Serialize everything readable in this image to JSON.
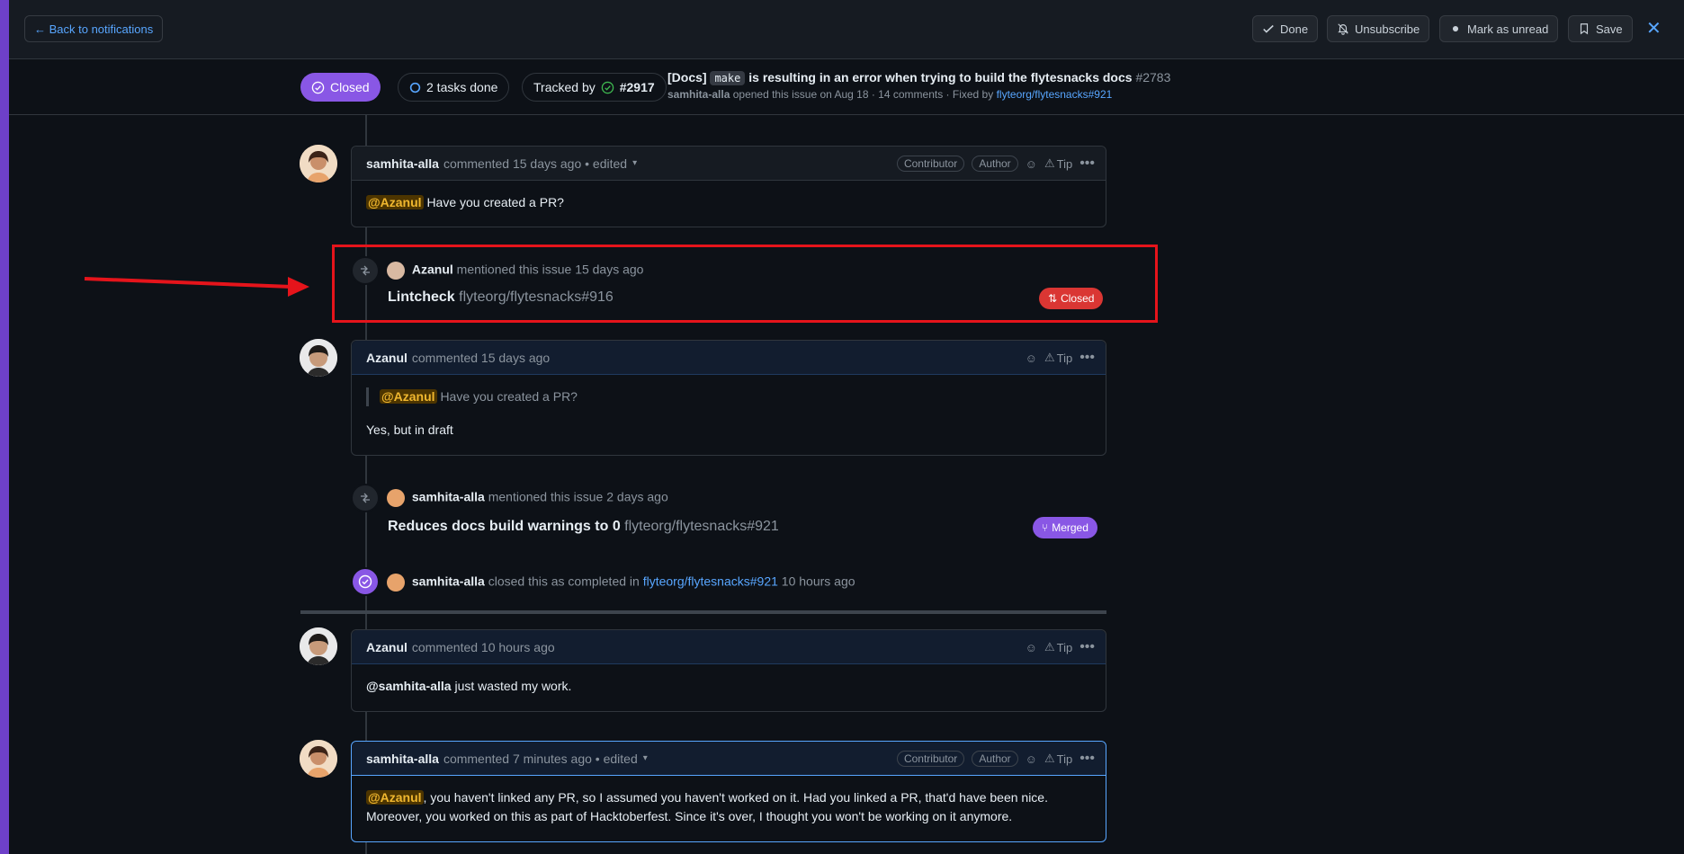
{
  "topbar": {
    "back_label": "← Back to notifications",
    "done_label": "Done",
    "unsubscribe_label": "Unsubscribe",
    "mark_unread_label": "Mark as unread",
    "save_label": "Save",
    "close_label": "✕"
  },
  "issue": {
    "state": "Closed",
    "tasks": "2 tasks done",
    "tracked_by_prefix": "Tracked by",
    "tracked_by_num": "#2917",
    "title_prefix": "[Docs]",
    "title_code": "make",
    "title_rest": "is resulting in an error when trying to build the flytesnacks docs",
    "number": "#2783",
    "sub_author": "samhita-alla",
    "sub_text": "opened this issue on Aug 18 · 14 comments · Fixed by",
    "sub_link": "flyteorg/flytesnacks#921"
  },
  "timeline": {
    "c1": {
      "author": "samhita-alla",
      "meta": "commented 15 days ago • edited",
      "labels": [
        "Contributor",
        "Author"
      ],
      "tip": "Tip",
      "mention": "@Azanul",
      "body": "Have you created a PR?"
    },
    "e1": {
      "actor": "Azanul",
      "text": "mentioned this issue 15 days ago",
      "ref_title": "Lintcheck",
      "ref_repo": "flyteorg/flytesnacks#916",
      "state": "Closed"
    },
    "c2": {
      "author": "Azanul",
      "meta": "commented 15 days ago",
      "tip": "Tip",
      "quote_mention": "@Azanul",
      "quote_text": "Have you created a PR?",
      "body": "Yes, but in draft"
    },
    "e2": {
      "actor": "samhita-alla",
      "text": "mentioned this issue 2 days ago",
      "ref_title": "Reduces docs build warnings to 0",
      "ref_repo": "flyteorg/flytesnacks#921",
      "state": "Merged"
    },
    "e3": {
      "actor": "samhita-alla",
      "text": "closed this as completed in",
      "link": "flyteorg/flytesnacks#921",
      "time": "10 hours ago"
    },
    "c3": {
      "author": "Azanul",
      "meta": "commented 10 hours ago",
      "tip": "Tip",
      "mention": "@samhita-alla",
      "body": "just wasted my work."
    },
    "c4": {
      "author": "samhita-alla",
      "meta": "commented 7 minutes ago • edited",
      "labels": [
        "Contributor",
        "Author"
      ],
      "tip": "Tip",
      "mention": "@Azanul",
      "body1": ", you haven't linked any PR, so I assumed you haven't worked on it. Had you linked a PR, that'd have been nice.",
      "body2": "Moreover, you worked on this as part of Hacktoberfest. Since it's over, I thought you won't be working on it anymore."
    }
  },
  "colors": {
    "closed_purple": "#8957e5",
    "closed_red": "#da3633",
    "annotation_red": "#e5141b",
    "link_blue": "#58a6ff"
  }
}
